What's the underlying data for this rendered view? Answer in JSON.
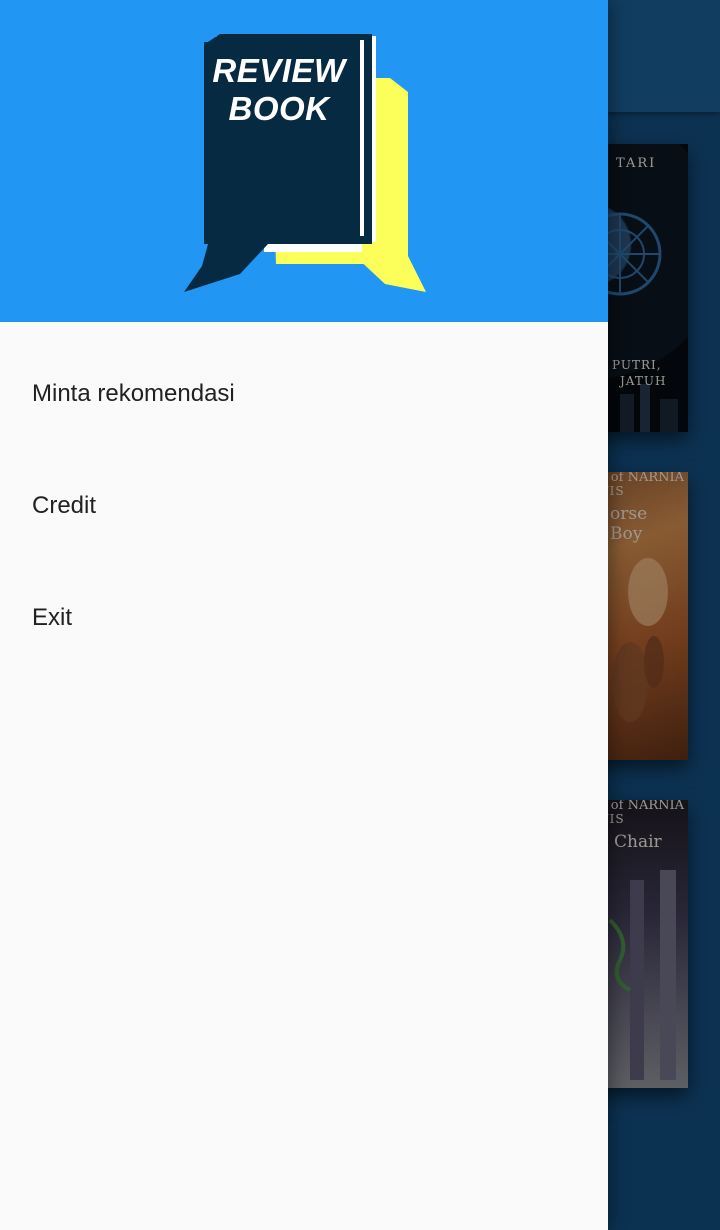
{
  "background_app": {
    "covers": [
      {
        "title_lines": [
          "TARI",
          "PUTRI,",
          "JATUH"
        ]
      },
      {
        "title_lines": [
          "s of NARNIA",
          "VIS",
          "orse",
          "Boy"
        ]
      },
      {
        "title_lines": [
          "s of NARNIA",
          "VIS",
          "Chair"
        ]
      }
    ]
  },
  "drawer": {
    "logo_text": [
      "REVIEW",
      "BOOK"
    ],
    "colors": {
      "header": "#2196f3",
      "book_dark": "#062a42",
      "book_yellow": "#fcff5a"
    },
    "menu": [
      {
        "label": "Minta rekomendasi"
      },
      {
        "label": "Credit"
      },
      {
        "label": "Exit"
      }
    ]
  }
}
